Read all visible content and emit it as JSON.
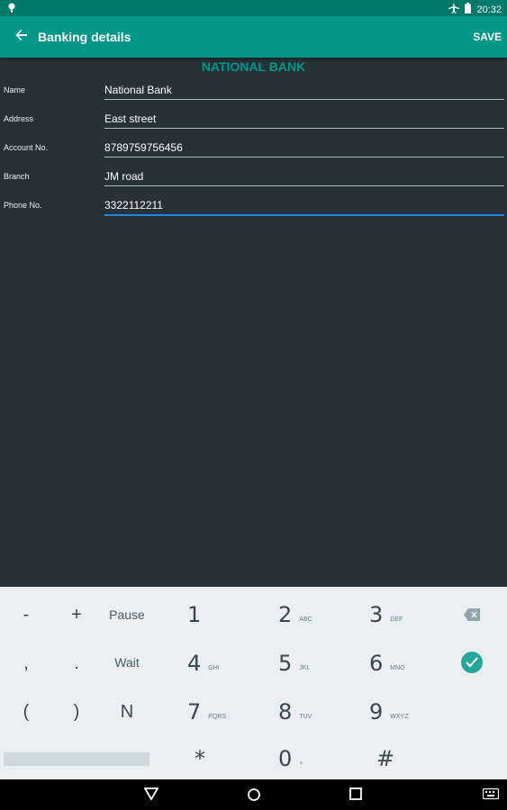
{
  "statusbar": {
    "time": "20:32"
  },
  "appbar": {
    "title": "Banking details",
    "save_label": "SAVE"
  },
  "heading": "NATIONAL BANK",
  "fields": [
    {
      "label": "Name",
      "value": "National Bank"
    },
    {
      "label": "Address",
      "value": "East street"
    },
    {
      "label": "Account No.",
      "value": "8789759756456"
    },
    {
      "label": "Branch",
      "value": "JM road"
    },
    {
      "label": "Phone No.",
      "value": "3322112211"
    }
  ],
  "keyboard": {
    "row1": {
      "k1": "-",
      "k2": "+",
      "k3": "Pause",
      "n1": "1",
      "n2": "2",
      "s2": "ABC",
      "n3": "3",
      "s3": "DEF"
    },
    "row2": {
      "k1": ",",
      "k2": ".",
      "k3": "Wait",
      "n1": "4",
      "s1": "GHI",
      "n2": "5",
      "s2": "JKL",
      "n3": "6",
      "s3": "MNO"
    },
    "row3": {
      "k1": "(",
      "k2": ")",
      "k3": "N",
      "n1": "7",
      "s1": "PQRS",
      "n2": "8",
      "s2": "TUV",
      "n3": "9",
      "s3": "WXYZ"
    },
    "row4": {
      "n1": "*",
      "n2": "0",
      "s2": "+",
      "n3": "#"
    }
  },
  "icons": {
    "back": "arrow-back-icon",
    "backspace": "backspace-icon",
    "done": "check-icon",
    "airplane": "airplane-icon",
    "battery": "battery-icon",
    "notification": "location-pin-icon"
  },
  "colors": {
    "primary": "#009688",
    "primary_dark": "#00796b",
    "background": "#263238",
    "accent": "#1e88e5"
  }
}
